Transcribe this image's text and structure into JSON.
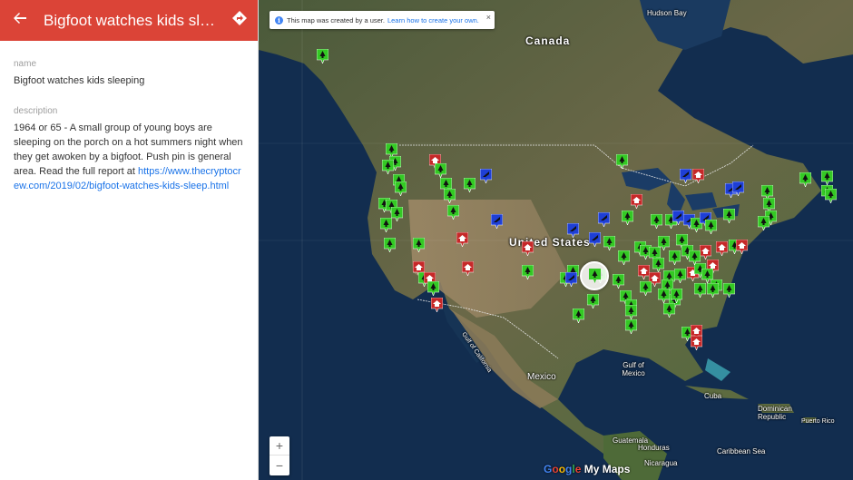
{
  "header": {
    "title": "Bigfoot watches kids sleepi...",
    "back_icon": "arrow-back-icon",
    "directions_icon": "directions-icon"
  },
  "detail": {
    "name_label": "name",
    "name_value": "Bigfoot watches kids sleeping",
    "description_label": "description",
    "description_text": "1964 or 65 - A small group of young boys are sleeping on the porch on a hot summers night when they get awoken by a bigfoot. Push pin is general area. Read the full report at ",
    "description_link": "https://www.thecryptocrew.com/2019/02/bigfoot-watches-kids-sleep.html"
  },
  "notice": {
    "text": "This map was created by a user.",
    "link": "Learn how to create your own.",
    "close": "×"
  },
  "map_labels": {
    "canada": "Canada",
    "united_states": "United States",
    "mexico": "Mexico",
    "hudson_bay": "Hudson Bay",
    "gulf_of_mexico": "Gulf of Mexico",
    "gulf_of_california": "Gulf of California",
    "cuba": "Cuba",
    "dominican_republic": "Dominican Republic",
    "puerto_rico": "Puerto Rico",
    "guatemala": "Guatemala",
    "honduras": "Honduras",
    "nicaragua": "Nicaragua",
    "caribbean_sea": "Caribbean Sea"
  },
  "zoom": {
    "in": "+",
    "out": "−"
  },
  "brand": {
    "g1": "G",
    "g2": "o",
    "g3": "o",
    "g4": "g",
    "g5": "l",
    "g6": "e",
    "rest": " My Maps"
  },
  "colors": {
    "header": "#db4437",
    "pin_green": "#34c924",
    "pin_red": "#c62828",
    "pin_blue": "#1e3fd6",
    "link": "#1a73e8"
  }
}
